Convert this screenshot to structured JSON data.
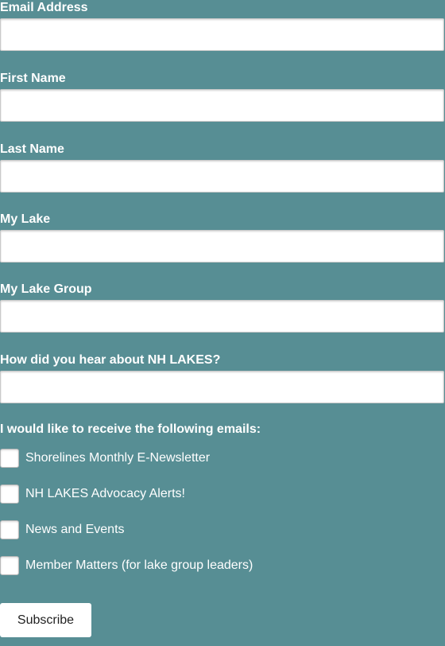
{
  "form": {
    "fields": [
      {
        "label": "Email Address",
        "value": "",
        "placeholder": ""
      },
      {
        "label": "First Name",
        "value": "",
        "placeholder": ""
      },
      {
        "label": "Last Name",
        "value": "",
        "placeholder": ""
      },
      {
        "label": "My Lake",
        "value": "",
        "placeholder": ""
      },
      {
        "label": "My Lake Group",
        "value": "",
        "placeholder": ""
      },
      {
        "label": "How did you hear about NH LAKES?",
        "value": "",
        "placeholder": ""
      }
    ],
    "emails_heading": "I would like to receive the following emails:",
    "email_options": [
      {
        "label": "Shorelines Monthly E-Newsletter",
        "checked": false
      },
      {
        "label": "NH LAKES Advocacy Alerts!",
        "checked": false
      },
      {
        "label": "News and Events",
        "checked": false
      },
      {
        "label": "Member Matters (for lake group leaders)",
        "checked": false
      }
    ],
    "subscribe_label": "Subscribe"
  },
  "colors": {
    "background": "#578e94",
    "label_text": "#ffffff",
    "input_background": "#ffffff",
    "button_text": "#222222"
  }
}
